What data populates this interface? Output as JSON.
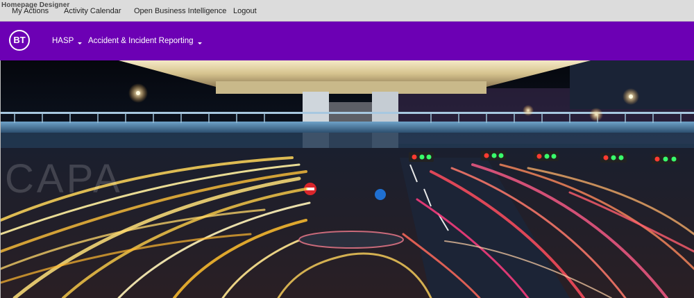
{
  "app_label": "Homepage Designer",
  "top_links": [
    {
      "label": "My Actions"
    },
    {
      "label": "Activity Calendar"
    },
    {
      "label": "Open Business Intelligence"
    },
    {
      "label": "Logout"
    }
  ],
  "logo": {
    "text": "BT"
  },
  "nav_menu": [
    {
      "label": "HASP",
      "has_dropdown": true
    },
    {
      "label": "Accident & Incident Reporting",
      "has_dropdown": true
    }
  ],
  "hero": {
    "watermark": "CAPA"
  },
  "colors": {
    "nav_background": "#6c00b4",
    "topbar_background": "#dcdcdc",
    "hero_night": "#0a0f1a"
  }
}
